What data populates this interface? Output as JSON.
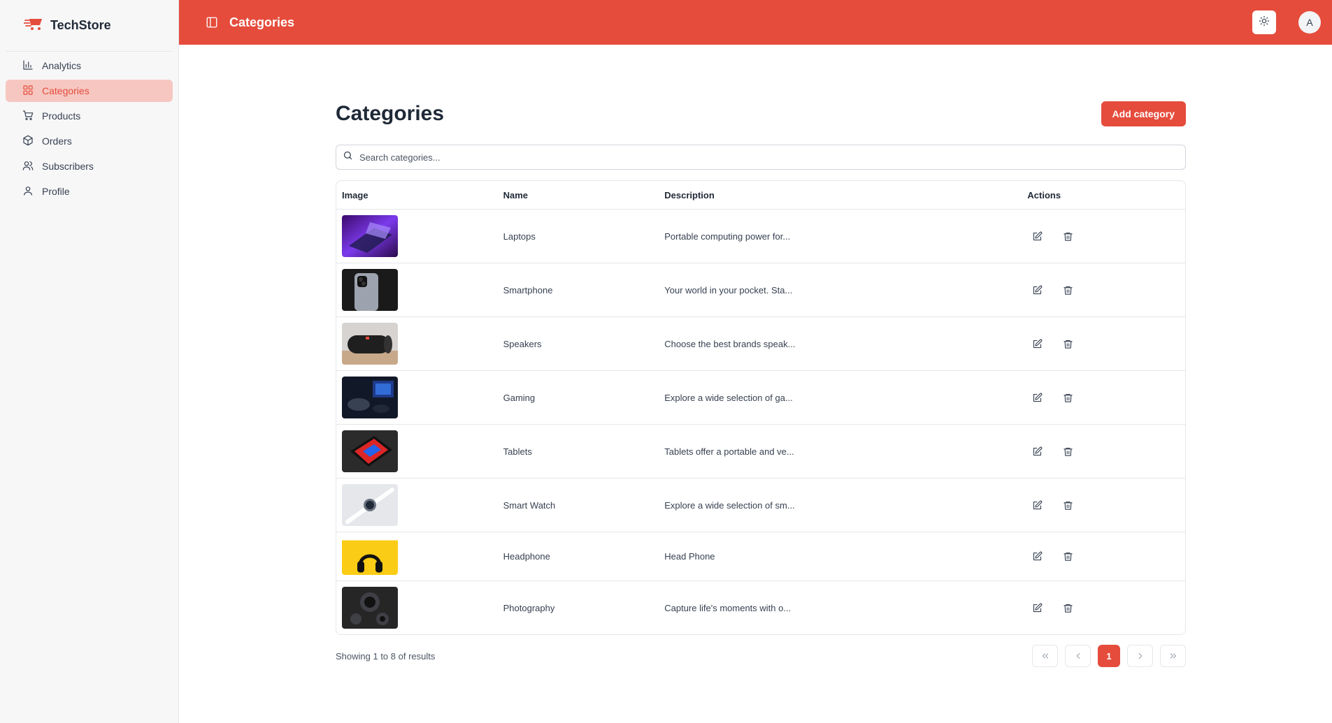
{
  "brand": {
    "name": "TechStore"
  },
  "sidebar": {
    "items": [
      {
        "label": "Analytics",
        "icon": "bar-chart-icon"
      },
      {
        "label": "Categories",
        "icon": "grid-icon",
        "active": true
      },
      {
        "label": "Products",
        "icon": "cart-icon"
      },
      {
        "label": "Orders",
        "icon": "package-icon"
      },
      {
        "label": "Subscribers",
        "icon": "users-icon"
      },
      {
        "label": "Profile",
        "icon": "user-icon"
      }
    ]
  },
  "topbar": {
    "title": "Categories",
    "avatar_initial": "A"
  },
  "page": {
    "title": "Categories",
    "add_label": "Add category",
    "search_placeholder": "Search categories..."
  },
  "table": {
    "headers": {
      "image": "Image",
      "name": "Name",
      "description": "Description",
      "actions": "Actions"
    },
    "rows": [
      {
        "name": "Laptops",
        "description": "Portable computing power for..."
      },
      {
        "name": "Smartphone",
        "description": "Your world in your pocket. Sta..."
      },
      {
        "name": "Speakers",
        "description": "Choose the best brands speak..."
      },
      {
        "name": "Gaming",
        "description": "Explore a wide selection of ga..."
      },
      {
        "name": "Tablets",
        "description": "Tablets offer a portable and ve..."
      },
      {
        "name": "Smart Watch",
        "description": "Explore a wide selection of sm..."
      },
      {
        "name": "Headphone",
        "description": "Head Phone"
      },
      {
        "name": "Photography",
        "description": "Capture life's moments with o..."
      }
    ]
  },
  "footer": {
    "showing": "Showing 1 to 8 of results",
    "current_page": "1"
  },
  "colors": {
    "accent": "#e54c3c",
    "active_bg": "#f6c7c1"
  }
}
